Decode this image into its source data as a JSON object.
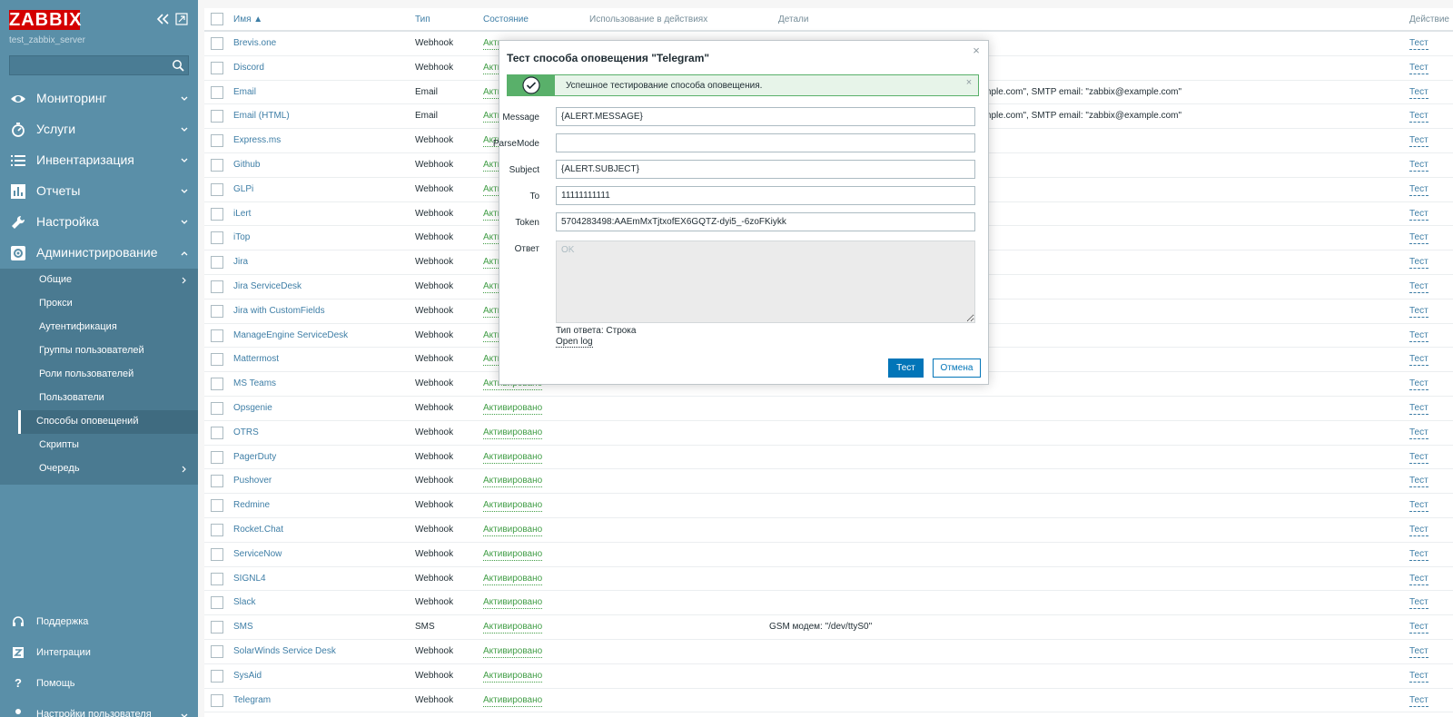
{
  "brand": {
    "logo_text": "ZABBIX",
    "server_name": "test_zabbix_server",
    "logo_color": "#d40000",
    "sidebar_color": "#5a8fa8"
  },
  "search": {
    "placeholder": ""
  },
  "nav": {
    "monitoring": "Мониторинг",
    "services": "Услуги",
    "inventory": "Инвентаризация",
    "reports": "Отчеты",
    "configuration": "Настройка",
    "administration": "Администрирование"
  },
  "admin_submenu": {
    "general": "Общие",
    "proxies": "Прокси",
    "authentication": "Аутентификация",
    "user_groups": "Группы пользователей",
    "user_roles": "Роли пользователей",
    "users": "Пользователи",
    "media_types": "Способы оповещений",
    "scripts": "Скрипты",
    "queue": "Очередь"
  },
  "bottom_nav": {
    "support": "Поддержка",
    "integrations": "Интеграции",
    "help": "Помощь",
    "user_settings": "Настройки пользователя"
  },
  "table": {
    "headers": {
      "name": "Имя ▲",
      "type": "Тип",
      "status": "Состояние",
      "used_in_actions": "Использование в действиях",
      "details": "Детали",
      "action": "Действие"
    },
    "rows": [
      {
        "name": "Brevis.one",
        "type": "Webhook",
        "status": "Активировано",
        "details": "",
        "action": "Тест"
      },
      {
        "name": "Discord",
        "type": "Webhook",
        "status": "Активировано",
        "details": "",
        "action": "Тест"
      },
      {
        "name": "Email",
        "type": "Email",
        "status": "Активировано",
        "details": "SMTP сервер: \"mail.example.com\", SMTP helo: \"example.com\", SMTP email: \"zabbix@example.com\"",
        "action": "Тест"
      },
      {
        "name": "Email (HTML)",
        "type": "Email",
        "status": "Активировано",
        "details": "SMTP сервер: \"mail.example.com\", SMTP helo: \"example.com\", SMTP email: \"zabbix@example.com\"",
        "action": "Тест"
      },
      {
        "name": "Express.ms",
        "type": "Webhook",
        "status": "Активировано",
        "details": "",
        "action": "Тест"
      },
      {
        "name": "Github",
        "type": "Webhook",
        "status": "Активировано",
        "details": "",
        "action": "Тест"
      },
      {
        "name": "GLPi",
        "type": "Webhook",
        "status": "Активировано",
        "details": "",
        "action": "Тест"
      },
      {
        "name": "iLert",
        "type": "Webhook",
        "status": "Активировано",
        "details": "",
        "action": "Тест"
      },
      {
        "name": "iTop",
        "type": "Webhook",
        "status": "Активировано",
        "details": "",
        "action": "Тест"
      },
      {
        "name": "Jira",
        "type": "Webhook",
        "status": "Активировано",
        "details": "",
        "action": "Тест"
      },
      {
        "name": "Jira ServiceDesk",
        "type": "Webhook",
        "status": "Активировано",
        "details": "",
        "action": "Тест"
      },
      {
        "name": "Jira with CustomFields",
        "type": "Webhook",
        "status": "Активировано",
        "details": "",
        "action": "Тест"
      },
      {
        "name": "ManageEngine ServiceDesk",
        "type": "Webhook",
        "status": "Активировано",
        "details": "",
        "action": "Тест"
      },
      {
        "name": "Mattermost",
        "type": "Webhook",
        "status": "Активировано",
        "details": "",
        "action": "Тест"
      },
      {
        "name": "MS Teams",
        "type": "Webhook",
        "status": "Активировано",
        "details": "",
        "action": "Тест"
      },
      {
        "name": "Opsgenie",
        "type": "Webhook",
        "status": "Активировано",
        "details": "",
        "action": "Тест"
      },
      {
        "name": "OTRS",
        "type": "Webhook",
        "status": "Активировано",
        "details": "",
        "action": "Тест"
      },
      {
        "name": "PagerDuty",
        "type": "Webhook",
        "status": "Активировано",
        "details": "",
        "action": "Тест"
      },
      {
        "name": "Pushover",
        "type": "Webhook",
        "status": "Активировано",
        "details": "",
        "action": "Тест"
      },
      {
        "name": "Redmine",
        "type": "Webhook",
        "status": "Активировано",
        "details": "",
        "action": "Тест"
      },
      {
        "name": "Rocket.Chat",
        "type": "Webhook",
        "status": "Активировано",
        "details": "",
        "action": "Тест"
      },
      {
        "name": "ServiceNow",
        "type": "Webhook",
        "status": "Активировано",
        "details": "",
        "action": "Тест"
      },
      {
        "name": "SIGNL4",
        "type": "Webhook",
        "status": "Активировано",
        "details": "",
        "action": "Тест"
      },
      {
        "name": "Slack",
        "type": "Webhook",
        "status": "Активировано",
        "details": "",
        "action": "Тест"
      },
      {
        "name": "SMS",
        "type": "SMS",
        "status": "Активировано",
        "details": "GSM модем: \"/dev/ttyS0\"",
        "action": "Тест"
      },
      {
        "name": "SolarWinds Service Desk",
        "type": "Webhook",
        "status": "Активировано",
        "details": "",
        "action": "Тест"
      },
      {
        "name": "SysAid",
        "type": "Webhook",
        "status": "Активировано",
        "details": "",
        "action": "Тест"
      },
      {
        "name": "Telegram",
        "type": "Webhook",
        "status": "Активировано",
        "details": "",
        "action": "Тест"
      }
    ]
  },
  "modal": {
    "title": "Тест способа оповещения \"Telegram\"",
    "success_message": "Успешное тестирование способа оповещения.",
    "fields": {
      "message": {
        "label": "Message",
        "value": "{ALERT.MESSAGE}"
      },
      "parsemode": {
        "label": "ParseMode",
        "value": ""
      },
      "subject": {
        "label": "Subject",
        "value": "{ALERT.SUBJECT}"
      },
      "to": {
        "label": "To",
        "value": "11111111111"
      },
      "token": {
        "label": "Token",
        "value": "5704283498:AAEmMxTjtxofEX6GQTZ-dyi5_-6zoFKiykk"
      }
    },
    "response": {
      "label": "Ответ",
      "value": "OK"
    },
    "response_type": "Тип ответа: Строка",
    "open_log": "Open log",
    "test_button": "Тест",
    "cancel_button": "Отмена"
  }
}
